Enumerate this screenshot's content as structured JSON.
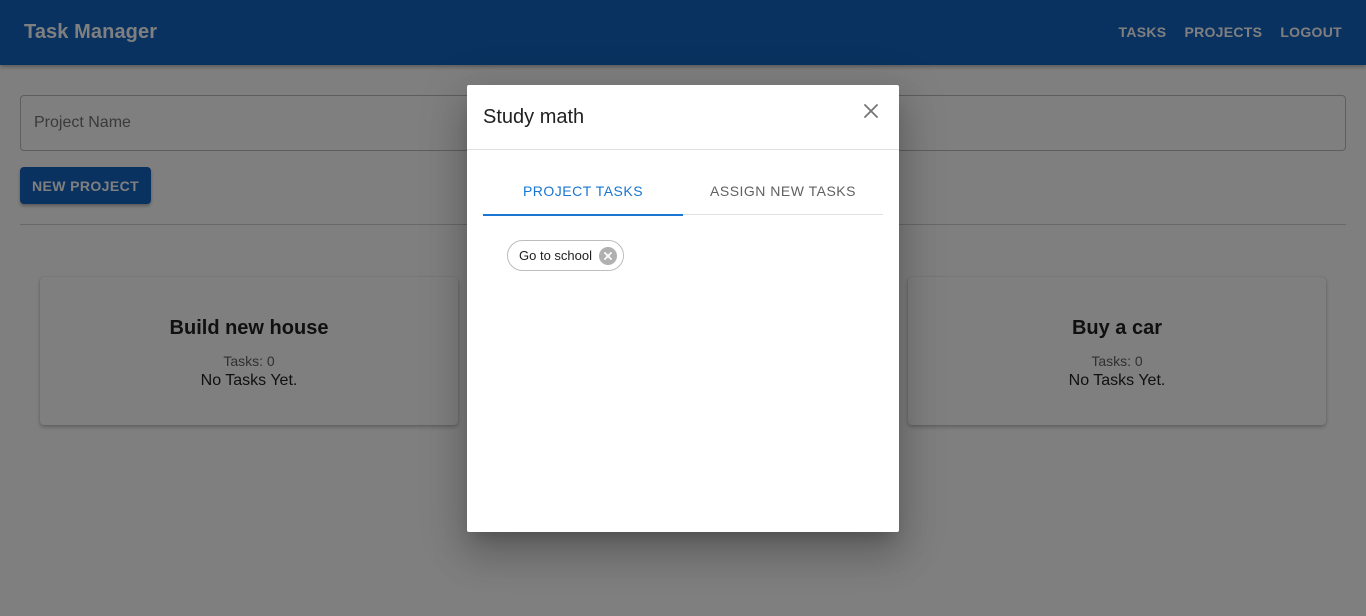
{
  "app": {
    "title": "Task Manager",
    "nav": [
      "TASKS",
      "PROJECTS",
      "LOGOUT"
    ]
  },
  "form": {
    "placeholder": "Project Name",
    "value": "",
    "submit_label": "NEW PROJECT"
  },
  "projects": [
    {
      "name": "Build new house",
      "tasks_label": "Tasks: 0",
      "empty_text": "No Tasks Yet."
    },
    {
      "name": "Buy a car",
      "tasks_label": "Tasks: 0",
      "empty_text": "No Tasks Yet."
    }
  ],
  "modal": {
    "title": "Study math",
    "tabs": [
      {
        "label": "PROJECT TASKS",
        "active": true
      },
      {
        "label": "ASSIGN NEW TASKS",
        "active": false
      }
    ],
    "chips": [
      {
        "label": "Go to school"
      }
    ]
  },
  "colors": {
    "primary": "#1565c0",
    "accent": "#1976d2",
    "backdrop": "rgba(0,0,0,0.5)"
  },
  "icons": {
    "close": "close-icon",
    "chip_delete": "cancel-icon"
  }
}
